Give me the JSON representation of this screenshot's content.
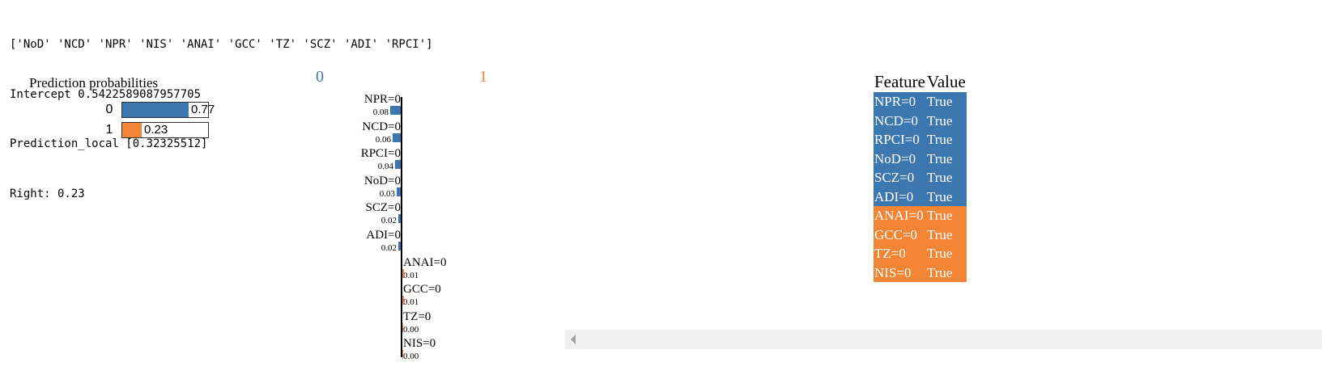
{
  "console": {
    "lines": [
      "['NoD' 'NCD' 'NPR' 'NIS' 'ANAI' 'GCC' 'TZ' 'SCZ' 'ADI' 'RPCI']",
      "Intercept 0.5422589087957705",
      "Prediction_local [0.32325512]",
      "Right: 0.23"
    ]
  },
  "prediction_probabilities": {
    "title": "Prediction probabilities",
    "rows": [
      {
        "label": "0",
        "value": 0.77,
        "value_text": "0.77",
        "color": "#3d77b0"
      },
      {
        "label": "1",
        "value": 0.23,
        "value_text": "0.23",
        "color": "#f28535"
      }
    ]
  },
  "explanation": {
    "class_labels": [
      {
        "text": "0",
        "color": "#3d77b0"
      },
      {
        "text": "1",
        "color": "#f28535"
      }
    ],
    "scale_max": 0.08,
    "features": [
      {
        "name": "NPR=0",
        "weight": 0.08,
        "weight_text": "0.08",
        "side": "negative"
      },
      {
        "name": "NCD=0",
        "weight": 0.06,
        "weight_text": "0.06",
        "side": "negative"
      },
      {
        "name": "RPCI=0",
        "weight": 0.04,
        "weight_text": "0.04",
        "side": "negative"
      },
      {
        "name": "NoD=0",
        "weight": 0.03,
        "weight_text": "0.03",
        "side": "negative"
      },
      {
        "name": "SCZ=0",
        "weight": 0.02,
        "weight_text": "0.02",
        "side": "negative"
      },
      {
        "name": "ADI=0",
        "weight": 0.02,
        "weight_text": "0.02",
        "side": "negative"
      },
      {
        "name": "ANAI=0",
        "weight": 0.01,
        "weight_text": "0.01",
        "side": "positive"
      },
      {
        "name": "GCC=0",
        "weight": 0.01,
        "weight_text": "0.01",
        "side": "positive"
      },
      {
        "name": "TZ=0",
        "weight": 0.0,
        "weight_text": "0.00",
        "side": "positive"
      },
      {
        "name": "NIS=0",
        "weight": 0.0,
        "weight_text": "0.00",
        "side": "positive"
      }
    ]
  },
  "feature_table": {
    "headers": [
      "Feature",
      "Value"
    ],
    "rows": [
      {
        "feature": "NPR=0",
        "value": "True",
        "color": "#3d77b0"
      },
      {
        "feature": "NCD=0",
        "value": "True",
        "color": "#3d77b0"
      },
      {
        "feature": "RPCI=0",
        "value": "True",
        "color": "#3d77b0"
      },
      {
        "feature": "NoD=0",
        "value": "True",
        "color": "#3d77b0"
      },
      {
        "feature": "SCZ=0",
        "value": "True",
        "color": "#3d77b0"
      },
      {
        "feature": "ADI=0",
        "value": "True",
        "color": "#3d77b0"
      },
      {
        "feature": "ANAI=0",
        "value": "True",
        "color": "#f28535"
      },
      {
        "feature": "GCC=0",
        "value": "True",
        "color": "#f28535"
      },
      {
        "feature": "TZ=0",
        "value": "True",
        "color": "#f28535"
      },
      {
        "feature": "NIS=0",
        "value": "True",
        "color": "#f28535"
      }
    ]
  },
  "scrollbar": {
    "icon": "chevron-left-icon"
  }
}
